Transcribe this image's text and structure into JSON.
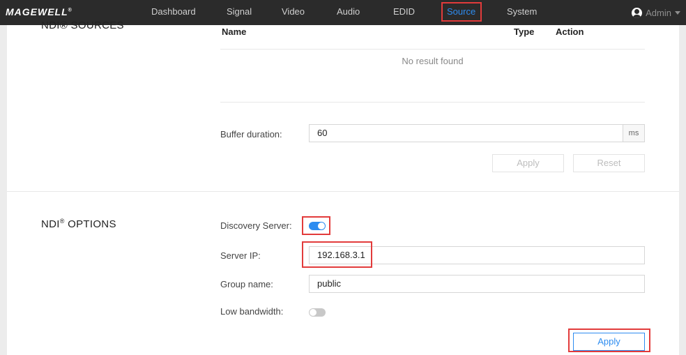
{
  "brand": {
    "logo": "MAGEWELL",
    "reg": "®"
  },
  "nav": {
    "items": [
      {
        "label": "Dashboard"
      },
      {
        "label": "Signal"
      },
      {
        "label": "Video"
      },
      {
        "label": "Audio"
      },
      {
        "label": "EDID"
      },
      {
        "label": "Source"
      },
      {
        "label": "System"
      }
    ],
    "active": "Source",
    "user": "Admin"
  },
  "ndi_sources": {
    "title": "NDI® SOURCES",
    "columns": {
      "name": "Name",
      "type": "Type",
      "action": "Action"
    },
    "empty_text": "No result found",
    "buffer_label": "Buffer duration:",
    "buffer_value": "60",
    "buffer_unit": "ms",
    "apply_label": "Apply",
    "reset_label": "Reset"
  },
  "ndi_options": {
    "title_main": "NDI",
    "title_reg": "®",
    "title_rest": " OPTIONS",
    "discovery_label": "Discovery Server:",
    "discovery_enabled": true,
    "server_ip_label": "Server IP:",
    "server_ip_value": "192.168.3.1",
    "group_label": "Group name:",
    "group_value": "public",
    "low_bw_label": "Low bandwidth:",
    "low_bw_enabled": false,
    "apply_label": "Apply"
  },
  "colors": {
    "accent": "#2d8cf0",
    "highlight": "#e23b3b",
    "nav_bg": "#2b2b2b"
  }
}
